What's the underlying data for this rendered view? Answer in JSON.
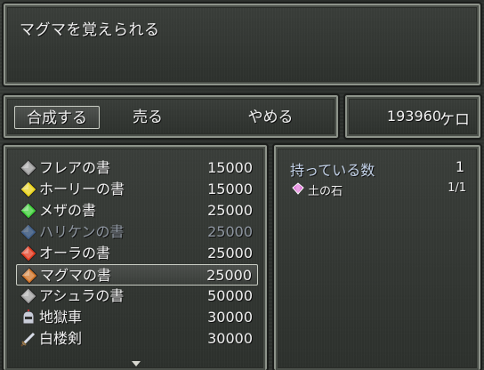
{
  "help": {
    "text": "マグマを覚えられる"
  },
  "commands": [
    {
      "label": "合成する",
      "selected": true
    },
    {
      "label": "売る",
      "selected": false
    },
    {
      "label": "やめる",
      "selected": false
    }
  ],
  "gold": {
    "value": "193960",
    "unit": "ケロ"
  },
  "items": [
    {
      "name": "フレアの書",
      "price": "15000",
      "icon": "gray-crystal-icon",
      "color": "#9a9a9a",
      "enabled": true,
      "selected": false
    },
    {
      "name": "ホーリーの書",
      "price": "15000",
      "icon": "yellow-crystal-icon",
      "color": "#e8d21a",
      "enabled": true,
      "selected": false
    },
    {
      "name": "メザの書",
      "price": "25000",
      "icon": "green-crystal-icon",
      "color": "#3fcf3a",
      "enabled": true,
      "selected": false
    },
    {
      "name": "ハリケンの書",
      "price": "25000",
      "icon": "blue-crystal-icon",
      "color": "#4a7fd0",
      "enabled": false,
      "selected": false
    },
    {
      "name": "オーラの書",
      "price": "25000",
      "icon": "red-crystal-icon",
      "color": "#e23a1e",
      "enabled": true,
      "selected": false
    },
    {
      "name": "マグマの書",
      "price": "25000",
      "icon": "orange-crystal-icon",
      "color": "#d07428",
      "enabled": true,
      "selected": true
    },
    {
      "name": "アシュラの書",
      "price": "50000",
      "icon": "gray-crystal-icon",
      "color": "#a0a0a0",
      "enabled": true,
      "selected": false
    },
    {
      "name": "地獄車",
      "price": "30000",
      "icon": "helmet-icon",
      "color": "#c8ccd8",
      "enabled": true,
      "selected": false
    },
    {
      "name": "白楼剣",
      "price": "30000",
      "icon": "sword-icon",
      "color": "#d8dce8",
      "enabled": true,
      "selected": false
    }
  ],
  "info": {
    "possess_label": "持っている数",
    "possess_count": "1",
    "materials": [
      {
        "name": "土の石",
        "count": "1/1",
        "icon": "pink-gem-icon",
        "color": "#e070d8"
      }
    ]
  }
}
